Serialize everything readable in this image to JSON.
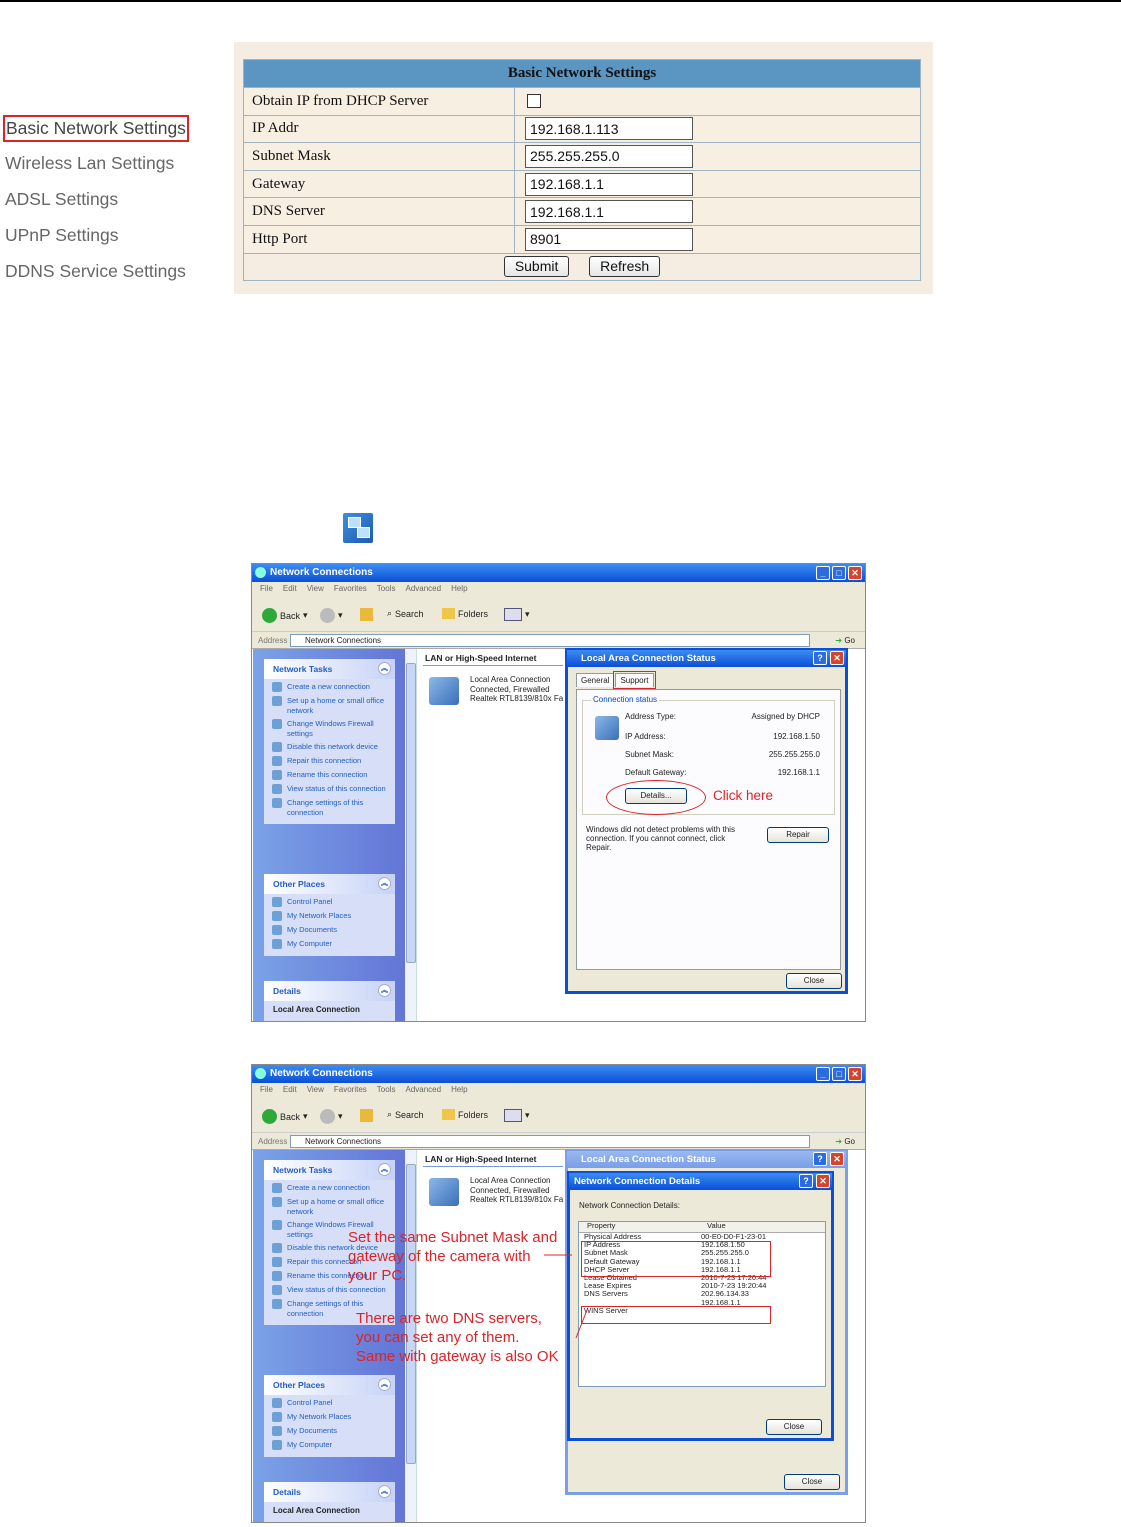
{
  "menu": {
    "items": [
      {
        "label": "Basic Network Settings",
        "active": true
      },
      {
        "label": "Wireless Lan Settings"
      },
      {
        "label": "ADSL Settings"
      },
      {
        "label": "UPnP Settings"
      },
      {
        "label": "DDNS Service Settings"
      }
    ]
  },
  "settings": {
    "title": "Basic Network Settings",
    "dhcp_label": "Obtain IP from DHCP Server",
    "dhcp_checked": false,
    "fields": [
      {
        "label": "IP Addr",
        "value": "192.168.1.113"
      },
      {
        "label": "Subnet Mask",
        "value": "255.255.255.0"
      },
      {
        "label": "Gateway",
        "value": "192.168.1.1"
      },
      {
        "label": "DNS Server",
        "value": "192.168.1.1"
      },
      {
        "label": "Http Port",
        "value": "8901"
      }
    ],
    "submit_label": "Submit",
    "refresh_label": "Refresh"
  },
  "explorer": {
    "title": "Network Connections",
    "menubar": [
      "File",
      "Edit",
      "View",
      "Favorites",
      "Tools",
      "Advanced",
      "Help"
    ],
    "back_label": "Back",
    "search_label": "Search",
    "folders_label": "Folders",
    "address_label": "Address",
    "address_value": "Network Connections",
    "go_label": "Go",
    "network_tasks": {
      "title": "Network Tasks",
      "items": [
        "Create a new connection",
        "Set up a home or small office network",
        "Change Windows Firewall settings",
        "Disable this network device",
        "Repair this connection",
        "Rename this connection",
        "View status of this connection",
        "Change settings of this connection"
      ]
    },
    "other_places": {
      "title": "Other Places",
      "items": [
        "Control Panel",
        "My Network Places",
        "My Documents",
        "My Computer"
      ]
    },
    "details": {
      "title": "Details",
      "subtitle": "Local Area Connection"
    },
    "lan_header": "LAN or High-Speed Internet",
    "connection": {
      "name": "Local Area Connection",
      "status": "Connected, Firewalled",
      "device": "Realtek RTL8139/810x Fa"
    }
  },
  "status_dialog": {
    "title": "Local Area Connection Status",
    "tabs": [
      "General",
      "Support"
    ],
    "group_label": "Connection status",
    "rows": [
      {
        "label": "Address Type:",
        "value": "Assigned by DHCP"
      },
      {
        "label": "IP Address:",
        "value": "192.168.1.50"
      },
      {
        "label": "Subnet Mask:",
        "value": "255.255.255.0"
      },
      {
        "label": "Default Gateway:",
        "value": "192.168.1.1"
      }
    ],
    "details_button": "Details...",
    "click_here": "Click here",
    "repair_text": "Windows did not detect problems with this connection. If you cannot connect, click Repair.",
    "repair_button": "Repair",
    "close_button": "Close"
  },
  "details_dialog": {
    "title": "Network Connection Details",
    "label": "Network Connection Details:",
    "col_property": "Property",
    "col_value": "Value",
    "rows": [
      {
        "property": "Physical Address",
        "value": "00-E0-D0-F1-23-01"
      },
      {
        "property": "IP Address",
        "value": "192.168.1.50"
      },
      {
        "property": "Subnet Mask",
        "value": "255.255.255.0"
      },
      {
        "property": "Default Gateway",
        "value": "192.168.1.1"
      },
      {
        "property": "DHCP Server",
        "value": "192.168.1.1"
      },
      {
        "property": "Lease Obtained",
        "value": "2010-7-23 17:20:44"
      },
      {
        "property": "Lease Expires",
        "value": "2010-7-23 19:20:44"
      },
      {
        "property": "DNS Servers",
        "value": "202.96.134.33"
      },
      {
        "property": "",
        "value": "192.168.1.1"
      },
      {
        "property": "WINS Server",
        "value": ""
      }
    ],
    "close_button": "Close"
  },
  "notes": {
    "note1": [
      "Set the same Subnet Mask and",
      "gateway of the camera with",
      "your PC."
    ],
    "note2": [
      "There are two DNS servers,",
      "you can set any of them.",
      "Same with gateway is also OK"
    ]
  }
}
